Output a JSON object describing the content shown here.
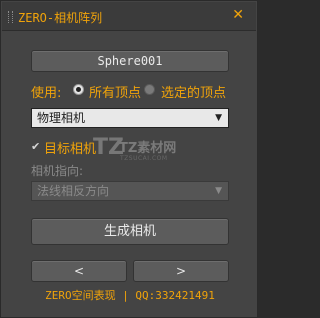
{
  "window": {
    "title": "ZERO-相机阵列",
    "close_glyph": "✕"
  },
  "object_button": {
    "label": "Sphere001"
  },
  "use": {
    "label": "使用:",
    "options": [
      {
        "label": "所有顶点",
        "selected": true
      },
      {
        "label": "选定的顶点",
        "selected": false
      }
    ]
  },
  "camera_type": {
    "selected": "物理相机"
  },
  "target_camera": {
    "label": "目标相机",
    "checked": true
  },
  "camera_direction": {
    "label": "相机指向:",
    "selected": "法线相反方向",
    "disabled": true
  },
  "generate_button": {
    "label": "生成相机"
  },
  "nav": {
    "prev": "<",
    "next": ">"
  },
  "footer": {
    "text": "ZERO空间表现 | QQ:332421491"
  },
  "watermark": {
    "logo": "TZ",
    "name": "TZ素材网",
    "url": "TZSUCAI.COM"
  },
  "colors": {
    "accent": "#f0a30a",
    "panel_bg": "#444444",
    "button_bg": "#5c5c5c"
  }
}
